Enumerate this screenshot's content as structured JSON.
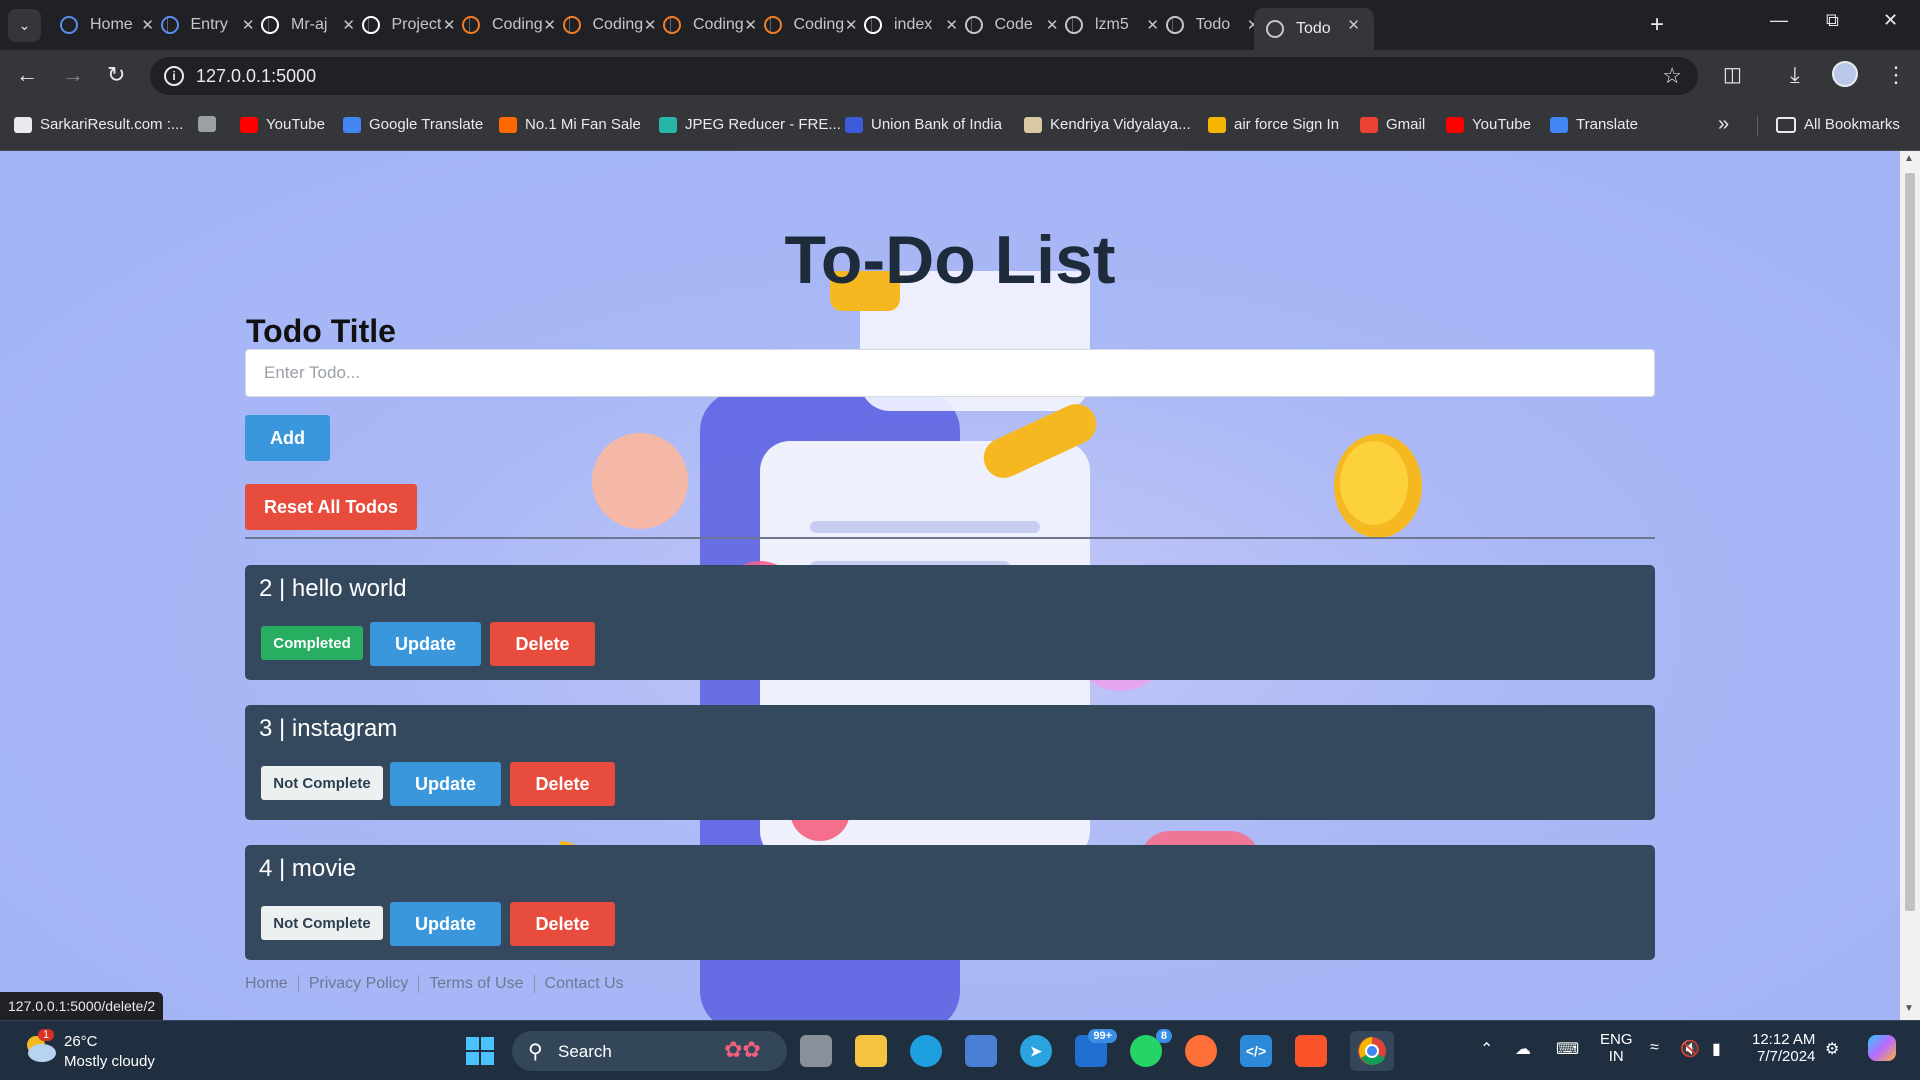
{
  "browser": {
    "tabs": [
      {
        "title": "Home",
        "icon": "c-circle-icon",
        "color": "#5b8dee"
      },
      {
        "title": "Entry",
        "icon": "c-circle-icon",
        "color": "#5b8dee"
      },
      {
        "title": "Mr-aj",
        "icon": "github-icon",
        "color": "#ffffff"
      },
      {
        "title": "Project",
        "icon": "chatgpt-icon",
        "color": "#ffffff"
      },
      {
        "title": "Coding",
        "icon": "codewithharry-icon",
        "color": "#f57c20"
      },
      {
        "title": "Coding",
        "icon": "codewithharry-icon",
        "color": "#f57c20"
      },
      {
        "title": "Coding",
        "icon": "codewithharry-icon",
        "color": "#f57c20"
      },
      {
        "title": "Coding",
        "icon": "codewithharry-icon",
        "color": "#f57c20"
      },
      {
        "title": "index",
        "icon": "codepen-icon",
        "color": "#ffffff"
      },
      {
        "title": "Code",
        "icon": "globe-icon",
        "color": "#c4c7c5"
      },
      {
        "title": "lzm5",
        "icon": "globe-icon",
        "color": "#c4c7c5"
      },
      {
        "title": "Todo",
        "icon": "globe-icon",
        "color": "#c4c7c5"
      },
      {
        "title": "Todo",
        "icon": "globe-icon",
        "color": "#c4c7c5",
        "active": true
      }
    ],
    "url": "127.0.0.1:5000",
    "bookmarks": [
      {
        "label": "SarkariResult.com :...",
        "color": "#e8eaed"
      },
      {
        "label": "",
        "color": "#9aa0a6"
      },
      {
        "label": "YouTube",
        "color": "#ff0000"
      },
      {
        "label": "Google Translate",
        "color": "#4285f4"
      },
      {
        "label": "No.1 Mi Fan Sale",
        "color": "#ff6900"
      },
      {
        "label": "JPEG Reducer - FRE...",
        "color": "#29b6a6"
      },
      {
        "label": "Union Bank of India",
        "color": "#3b5bdb"
      },
      {
        "label": "Kendriya Vidyalaya...",
        "color": "#d9c9a3"
      },
      {
        "label": "air force Sign In",
        "color": "#f4b400"
      },
      {
        "label": "Gmail",
        "color": "#ea4335"
      },
      {
        "label": "YouTube",
        "color": "#ff0000"
      },
      {
        "label": "Translate",
        "color": "#4285f4"
      }
    ],
    "all_bookmarks": "All Bookmarks",
    "status_url": "127.0.0.1:5000/delete/2"
  },
  "page": {
    "title": "To-Do List",
    "form_label": "Todo Title",
    "input_placeholder": "Enter Todo...",
    "add_label": "Add",
    "reset_label": "Reset All Todos",
    "todos": [
      {
        "title": "2 | hello world",
        "status": "Completed",
        "done": true
      },
      {
        "title": "3 | instagram",
        "status": "Not Complete",
        "done": false
      },
      {
        "title": "4 | movie",
        "status": "Not Complete",
        "done": false
      }
    ],
    "update_label": "Update",
    "delete_label": "Delete",
    "footer_links": [
      "Home",
      "Privacy Policy",
      "Terms of Use",
      "Contact Us"
    ]
  },
  "taskbar": {
    "temp": "26°C",
    "weather": "Mostly cloudy",
    "weather_badge": "1",
    "search": "Search",
    "outlook_badge": "99+",
    "whatsapp_badge": "8",
    "lang1": "ENG",
    "lang2": "IN",
    "time": "12:12 AM",
    "date": "7/7/2024"
  },
  "colors": {
    "primary": "#3a97db",
    "danger": "#e74c3c",
    "success": "#27ae60",
    "card": "#34495e"
  }
}
